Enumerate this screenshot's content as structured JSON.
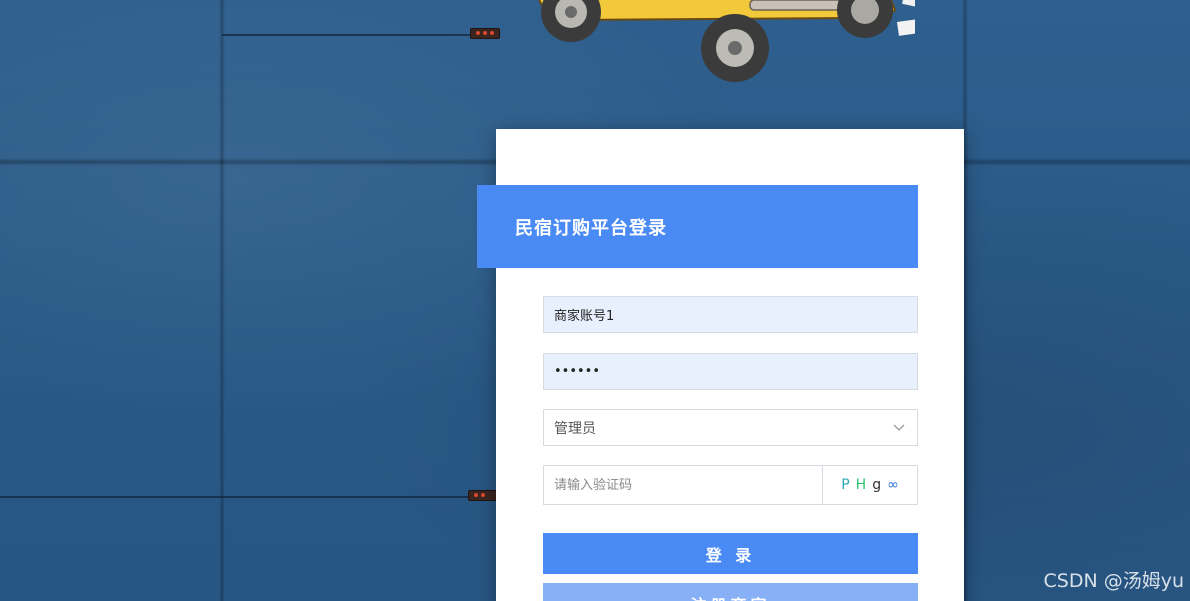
{
  "login": {
    "title": "民宿订购平台登录",
    "username_value": "商家账号1",
    "password_value": "••••••",
    "role_selected": "管理员",
    "captcha_placeholder": "请输入验证码",
    "captcha_chars": [
      "P",
      "H",
      "g",
      "∞"
    ],
    "captcha_colors": [
      "#27a9b8",
      "#2fbf6f",
      "#333333",
      "#2f74d8"
    ],
    "login_label": "登 录",
    "register_label": "注册商家"
  },
  "watermark": "CSDN @汤姆yu",
  "colors": {
    "accent": "#4a8af4",
    "register": "#88b0f7",
    "field_fill": "#e8f0fe"
  }
}
